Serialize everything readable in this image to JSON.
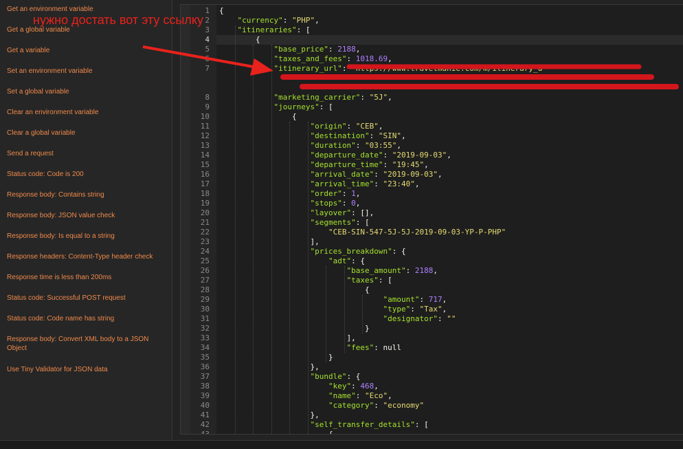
{
  "snippets": [
    "Get an environment variable",
    "Get a global variable",
    "Get a variable",
    "Set an environment variable",
    "Set a global variable",
    "Clear an environment variable",
    "Clear a global variable",
    "Send a request",
    "Status code: Code is 200",
    "Response body: Contains string",
    "Response body: JSON value check",
    "Response body: Is equal to a string",
    "Response headers: Content-Type header check",
    "Response time is less than 200ms",
    "Status code: Successful POST request",
    "Status code: Code name has string",
    "Response body: Convert XML body to a JSON Object",
    "Use Tiny Validator for JSON data"
  ],
  "annotation": "нужно достать вот эту ссылку",
  "editor": {
    "line_numbers": [
      "1",
      "2",
      "3",
      "4",
      "5",
      "6",
      "7",
      "8",
      "9",
      "10",
      "11",
      "12",
      "13",
      "14",
      "15",
      "16",
      "17",
      "18",
      "19",
      "20",
      "21",
      "22",
      "23",
      "24",
      "25",
      "26",
      "27",
      "28",
      "29",
      "30",
      "31",
      "32",
      "33",
      "34",
      "35",
      "36",
      "37",
      "38",
      "39",
      "40",
      "41",
      "42",
      "43"
    ],
    "lines": [
      {
        "indent": 0,
        "t": [
          [
            "p",
            "{"
          ]
        ]
      },
      {
        "indent": 1,
        "t": [
          [
            "k",
            "\"currency\""
          ],
          [
            "p",
            ": "
          ],
          [
            "s",
            "\"PHP\""
          ],
          [
            "p",
            ","
          ]
        ]
      },
      {
        "indent": 1,
        "t": [
          [
            "k",
            "\"itineraries\""
          ],
          [
            "p",
            ": ["
          ]
        ]
      },
      {
        "indent": 2,
        "t": [
          [
            "p",
            "{"
          ]
        ]
      },
      {
        "indent": 3,
        "t": [
          [
            "k",
            "\"base_price\""
          ],
          [
            "p",
            ": "
          ],
          [
            "n",
            "2188"
          ],
          [
            "p",
            ","
          ]
        ]
      },
      {
        "indent": 3,
        "t": [
          [
            "k",
            "\"taxes_and_fees\""
          ],
          [
            "p",
            ": "
          ],
          [
            "n",
            "1018.69"
          ],
          [
            "p",
            ","
          ]
        ]
      },
      {
        "indent": 3,
        "t": [
          [
            "k",
            "\"itinerary_url\""
          ],
          [
            "p",
            ": "
          ],
          [
            "s",
            "\"https://www.travelmanie.com/m/itinerary_u"
          ]
        ]
      },
      {
        "indent": 3,
        "t": [
          [
            "k",
            "\"marketing_carrier\""
          ],
          [
            "p",
            ": "
          ],
          [
            "s",
            "\"5J\""
          ],
          [
            "p",
            ","
          ]
        ]
      },
      {
        "indent": 3,
        "t": [
          [
            "k",
            "\"journeys\""
          ],
          [
            "p",
            ": ["
          ]
        ]
      },
      {
        "indent": 4,
        "t": [
          [
            "p",
            "{"
          ]
        ]
      },
      {
        "indent": 5,
        "t": [
          [
            "k",
            "\"origin\""
          ],
          [
            "p",
            ": "
          ],
          [
            "s",
            "\"CEB\""
          ],
          [
            "p",
            ","
          ]
        ]
      },
      {
        "indent": 5,
        "t": [
          [
            "k",
            "\"destination\""
          ],
          [
            "p",
            ": "
          ],
          [
            "s",
            "\"SIN\""
          ],
          [
            "p",
            ","
          ]
        ]
      },
      {
        "indent": 5,
        "t": [
          [
            "k",
            "\"duration\""
          ],
          [
            "p",
            ": "
          ],
          [
            "s",
            "\"03:55\""
          ],
          [
            "p",
            ","
          ]
        ]
      },
      {
        "indent": 5,
        "t": [
          [
            "k",
            "\"departure_date\""
          ],
          [
            "p",
            ": "
          ],
          [
            "s",
            "\"2019-09-03\""
          ],
          [
            "p",
            ","
          ]
        ]
      },
      {
        "indent": 5,
        "t": [
          [
            "k",
            "\"departure_time\""
          ],
          [
            "p",
            ": "
          ],
          [
            "s",
            "\"19:45\""
          ],
          [
            "p",
            ","
          ]
        ]
      },
      {
        "indent": 5,
        "t": [
          [
            "k",
            "\"arrival_date\""
          ],
          [
            "p",
            ": "
          ],
          [
            "s",
            "\"2019-09-03\""
          ],
          [
            "p",
            ","
          ]
        ]
      },
      {
        "indent": 5,
        "t": [
          [
            "k",
            "\"arrival_time\""
          ],
          [
            "p",
            ": "
          ],
          [
            "s",
            "\"23:40\""
          ],
          [
            "p",
            ","
          ]
        ]
      },
      {
        "indent": 5,
        "t": [
          [
            "k",
            "\"order\""
          ],
          [
            "p",
            ": "
          ],
          [
            "n",
            "1"
          ],
          [
            "p",
            ","
          ]
        ]
      },
      {
        "indent": 5,
        "t": [
          [
            "k",
            "\"stops\""
          ],
          [
            "p",
            ": "
          ],
          [
            "n",
            "0"
          ],
          [
            "p",
            ","
          ]
        ]
      },
      {
        "indent": 5,
        "t": [
          [
            "k",
            "\"layover\""
          ],
          [
            "p",
            ": [],"
          ]
        ]
      },
      {
        "indent": 5,
        "t": [
          [
            "k",
            "\"segments\""
          ],
          [
            "p",
            ": ["
          ]
        ]
      },
      {
        "indent": 6,
        "t": [
          [
            "s",
            "\"CEB-SIN-547-5J-5J-2019-09-03-YP-P-PHP\""
          ]
        ]
      },
      {
        "indent": 5,
        "t": [
          [
            "p",
            "],"
          ]
        ]
      },
      {
        "indent": 5,
        "t": [
          [
            "k",
            "\"prices_breakdown\""
          ],
          [
            "p",
            ": {"
          ]
        ]
      },
      {
        "indent": 6,
        "t": [
          [
            "k",
            "\"adt\""
          ],
          [
            "p",
            ": {"
          ]
        ]
      },
      {
        "indent": 7,
        "t": [
          [
            "k",
            "\"base_amount\""
          ],
          [
            "p",
            ": "
          ],
          [
            "n",
            "2188"
          ],
          [
            "p",
            ","
          ]
        ]
      },
      {
        "indent": 7,
        "t": [
          [
            "k",
            "\"taxes\""
          ],
          [
            "p",
            ": ["
          ]
        ]
      },
      {
        "indent": 8,
        "t": [
          [
            "p",
            "{"
          ]
        ]
      },
      {
        "indent": 9,
        "t": [
          [
            "k",
            "\"amount\""
          ],
          [
            "p",
            ": "
          ],
          [
            "n",
            "717"
          ],
          [
            "p",
            ","
          ]
        ]
      },
      {
        "indent": 9,
        "t": [
          [
            "k",
            "\"type\""
          ],
          [
            "p",
            ": "
          ],
          [
            "s",
            "\"Tax\""
          ],
          [
            "p",
            ","
          ]
        ]
      },
      {
        "indent": 9,
        "t": [
          [
            "k",
            "\"designator\""
          ],
          [
            "p",
            ": "
          ],
          [
            "s",
            "\"\""
          ]
        ]
      },
      {
        "indent": 8,
        "t": [
          [
            "p",
            "}"
          ]
        ]
      },
      {
        "indent": 7,
        "t": [
          [
            "p",
            "],"
          ]
        ]
      },
      {
        "indent": 7,
        "t": [
          [
            "k",
            "\"fees\""
          ],
          [
            "p",
            ": "
          ],
          [
            "c",
            "null"
          ]
        ]
      },
      {
        "indent": 6,
        "t": [
          [
            "p",
            "}"
          ]
        ]
      },
      {
        "indent": 5,
        "t": [
          [
            "p",
            "},"
          ]
        ]
      },
      {
        "indent": 5,
        "t": [
          [
            "k",
            "\"bundle\""
          ],
          [
            "p",
            ": {"
          ]
        ]
      },
      {
        "indent": 6,
        "t": [
          [
            "k",
            "\"key\""
          ],
          [
            "p",
            ": "
          ],
          [
            "n",
            "468"
          ],
          [
            "p",
            ","
          ]
        ]
      },
      {
        "indent": 6,
        "t": [
          [
            "k",
            "\"name\""
          ],
          [
            "p",
            ": "
          ],
          [
            "s",
            "\"Eco\""
          ],
          [
            "p",
            ","
          ]
        ]
      },
      {
        "indent": 6,
        "t": [
          [
            "k",
            "\"category\""
          ],
          [
            "p",
            ": "
          ],
          [
            "s",
            "\"economy\""
          ]
        ]
      },
      {
        "indent": 5,
        "t": [
          [
            "p",
            "},"
          ]
        ]
      },
      {
        "indent": 5,
        "t": [
          [
            "k",
            "\"self_transfer_details\""
          ],
          [
            "p",
            ": ["
          ]
        ]
      },
      {
        "indent": 6,
        "t": [
          [
            "p",
            "{"
          ]
        ]
      }
    ]
  },
  "colors": {
    "snippet_text": "#f08a4b",
    "annotation_red": "#e8221c",
    "json_key": "#a6e22e",
    "json_string": "#e6db74",
    "json_number": "#ae81ff"
  }
}
